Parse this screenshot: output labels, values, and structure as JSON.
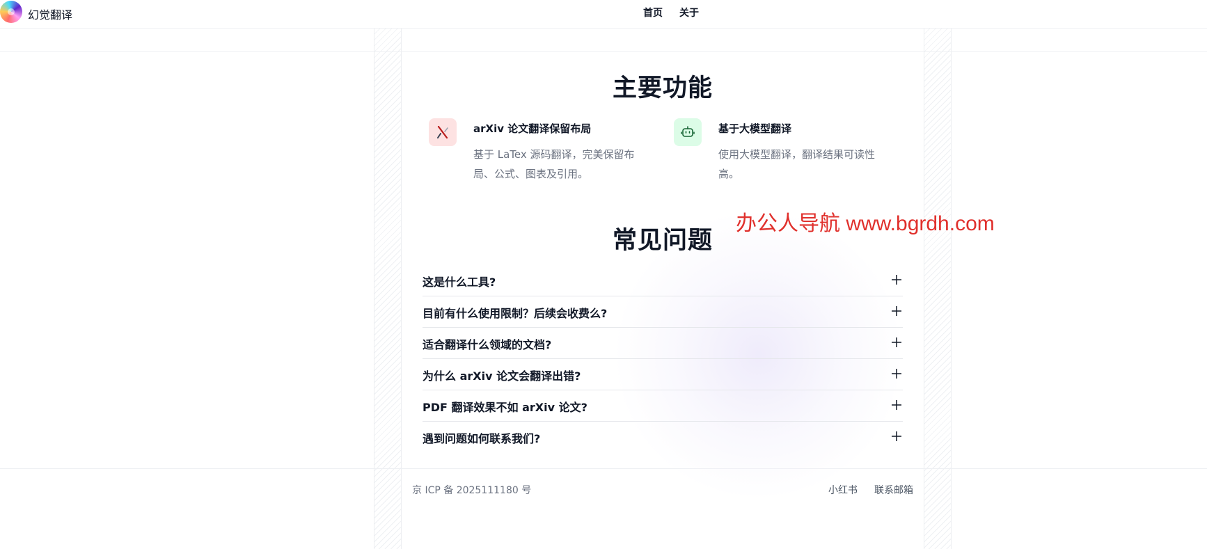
{
  "header": {
    "brand": "幻觉翻译",
    "nav": [
      {
        "label": "首页"
      },
      {
        "label": "关于"
      }
    ]
  },
  "features": {
    "title": "主要功能",
    "items": [
      {
        "icon": "latex-document-icon",
        "icon_bg": "#fde2e2",
        "title": "arXiv 论文翻译保留布局",
        "desc": "基于 LaTex 源码翻译，完美保留布局、公式、图表及引用。"
      },
      {
        "icon": "robot-icon",
        "icon_bg": "#dcfce7",
        "title": "基于大模型翻译",
        "desc": "使用大模型翻译，翻译结果可读性高。"
      }
    ]
  },
  "faq": {
    "title": "常见问题",
    "items": [
      {
        "q": "这是什么工具?"
      },
      {
        "q": "目前有什么使用限制？后续会收费么?"
      },
      {
        "q": "适合翻译什么领域的文档?"
      },
      {
        "q": "为什么 arXiv 论文会翻译出错?"
      },
      {
        "q": "PDF 翻译效果不如 arXiv 论文?"
      },
      {
        "q": "遇到问题如何联系我们?"
      }
    ]
  },
  "watermark": "办公人导航  www.bgrdh.com",
  "footer": {
    "icp": "京 ICP 备 2025111180 号",
    "links": [
      {
        "label": "小红书"
      },
      {
        "label": "联系邮箱"
      }
    ]
  },
  "colors": {
    "accent_red": "#e0302c",
    "text_primary": "#111827",
    "text_muted": "#6b7280"
  }
}
